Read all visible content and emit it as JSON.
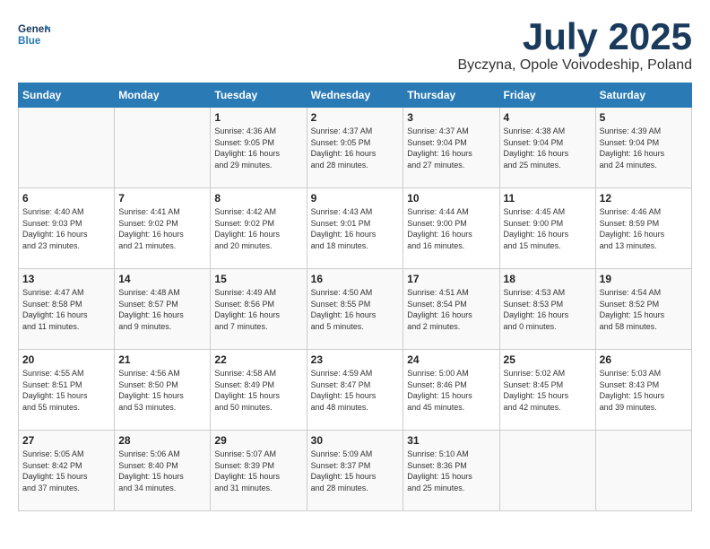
{
  "header": {
    "logo_line1": "General",
    "logo_line2": "Blue",
    "month": "July 2025",
    "location": "Byczyna, Opole Voivodeship, Poland"
  },
  "weekdays": [
    "Sunday",
    "Monday",
    "Tuesday",
    "Wednesday",
    "Thursday",
    "Friday",
    "Saturday"
  ],
  "weeks": [
    [
      {
        "day": "",
        "info": ""
      },
      {
        "day": "",
        "info": ""
      },
      {
        "day": "1",
        "info": "Sunrise: 4:36 AM\nSunset: 9:05 PM\nDaylight: 16 hours\nand 29 minutes."
      },
      {
        "day": "2",
        "info": "Sunrise: 4:37 AM\nSunset: 9:05 PM\nDaylight: 16 hours\nand 28 minutes."
      },
      {
        "day": "3",
        "info": "Sunrise: 4:37 AM\nSunset: 9:04 PM\nDaylight: 16 hours\nand 27 minutes."
      },
      {
        "day": "4",
        "info": "Sunrise: 4:38 AM\nSunset: 9:04 PM\nDaylight: 16 hours\nand 25 minutes."
      },
      {
        "day": "5",
        "info": "Sunrise: 4:39 AM\nSunset: 9:04 PM\nDaylight: 16 hours\nand 24 minutes."
      }
    ],
    [
      {
        "day": "6",
        "info": "Sunrise: 4:40 AM\nSunset: 9:03 PM\nDaylight: 16 hours\nand 23 minutes."
      },
      {
        "day": "7",
        "info": "Sunrise: 4:41 AM\nSunset: 9:02 PM\nDaylight: 16 hours\nand 21 minutes."
      },
      {
        "day": "8",
        "info": "Sunrise: 4:42 AM\nSunset: 9:02 PM\nDaylight: 16 hours\nand 20 minutes."
      },
      {
        "day": "9",
        "info": "Sunrise: 4:43 AM\nSunset: 9:01 PM\nDaylight: 16 hours\nand 18 minutes."
      },
      {
        "day": "10",
        "info": "Sunrise: 4:44 AM\nSunset: 9:00 PM\nDaylight: 16 hours\nand 16 minutes."
      },
      {
        "day": "11",
        "info": "Sunrise: 4:45 AM\nSunset: 9:00 PM\nDaylight: 16 hours\nand 15 minutes."
      },
      {
        "day": "12",
        "info": "Sunrise: 4:46 AM\nSunset: 8:59 PM\nDaylight: 16 hours\nand 13 minutes."
      }
    ],
    [
      {
        "day": "13",
        "info": "Sunrise: 4:47 AM\nSunset: 8:58 PM\nDaylight: 16 hours\nand 11 minutes."
      },
      {
        "day": "14",
        "info": "Sunrise: 4:48 AM\nSunset: 8:57 PM\nDaylight: 16 hours\nand 9 minutes."
      },
      {
        "day": "15",
        "info": "Sunrise: 4:49 AM\nSunset: 8:56 PM\nDaylight: 16 hours\nand 7 minutes."
      },
      {
        "day": "16",
        "info": "Sunrise: 4:50 AM\nSunset: 8:55 PM\nDaylight: 16 hours\nand 5 minutes."
      },
      {
        "day": "17",
        "info": "Sunrise: 4:51 AM\nSunset: 8:54 PM\nDaylight: 16 hours\nand 2 minutes."
      },
      {
        "day": "18",
        "info": "Sunrise: 4:53 AM\nSunset: 8:53 PM\nDaylight: 16 hours\nand 0 minutes."
      },
      {
        "day": "19",
        "info": "Sunrise: 4:54 AM\nSunset: 8:52 PM\nDaylight: 15 hours\nand 58 minutes."
      }
    ],
    [
      {
        "day": "20",
        "info": "Sunrise: 4:55 AM\nSunset: 8:51 PM\nDaylight: 15 hours\nand 55 minutes."
      },
      {
        "day": "21",
        "info": "Sunrise: 4:56 AM\nSunset: 8:50 PM\nDaylight: 15 hours\nand 53 minutes."
      },
      {
        "day": "22",
        "info": "Sunrise: 4:58 AM\nSunset: 8:49 PM\nDaylight: 15 hours\nand 50 minutes."
      },
      {
        "day": "23",
        "info": "Sunrise: 4:59 AM\nSunset: 8:47 PM\nDaylight: 15 hours\nand 48 minutes."
      },
      {
        "day": "24",
        "info": "Sunrise: 5:00 AM\nSunset: 8:46 PM\nDaylight: 15 hours\nand 45 minutes."
      },
      {
        "day": "25",
        "info": "Sunrise: 5:02 AM\nSunset: 8:45 PM\nDaylight: 15 hours\nand 42 minutes."
      },
      {
        "day": "26",
        "info": "Sunrise: 5:03 AM\nSunset: 8:43 PM\nDaylight: 15 hours\nand 39 minutes."
      }
    ],
    [
      {
        "day": "27",
        "info": "Sunrise: 5:05 AM\nSunset: 8:42 PM\nDaylight: 15 hours\nand 37 minutes."
      },
      {
        "day": "28",
        "info": "Sunrise: 5:06 AM\nSunset: 8:40 PM\nDaylight: 15 hours\nand 34 minutes."
      },
      {
        "day": "29",
        "info": "Sunrise: 5:07 AM\nSunset: 8:39 PM\nDaylight: 15 hours\nand 31 minutes."
      },
      {
        "day": "30",
        "info": "Sunrise: 5:09 AM\nSunset: 8:37 PM\nDaylight: 15 hours\nand 28 minutes."
      },
      {
        "day": "31",
        "info": "Sunrise: 5:10 AM\nSunset: 8:36 PM\nDaylight: 15 hours\nand 25 minutes."
      },
      {
        "day": "",
        "info": ""
      },
      {
        "day": "",
        "info": ""
      }
    ]
  ]
}
